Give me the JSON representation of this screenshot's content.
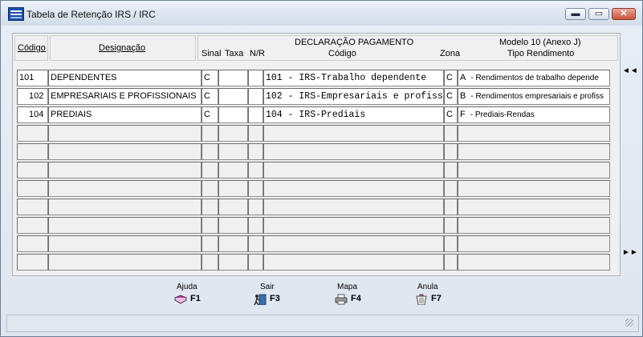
{
  "window": {
    "title": "Tabela de Retenção IRS / IRC",
    "controls": {
      "minimize": "▬",
      "maximize": "▭",
      "close": "✕"
    }
  },
  "header": {
    "codigo": "Código",
    "designacao": "Designação",
    "sinal": "Sinal",
    "taxa": "Taxa",
    "nr": "N/R",
    "declaracao": "DECLARAÇÃO PAGAMENTO",
    "declaracao_codigo": "Código",
    "zona": "Zona",
    "modelo": "Modelo 10 (Anexo J)",
    "tipo_rendimento": "Tipo Rendimento"
  },
  "rows": [
    {
      "codigo": "101",
      "designacao": "DEPENDENTES",
      "sinal": "C",
      "taxa": "",
      "nr": "",
      "dp_codigo": "101 - IRS-Trabalho dependente",
      "zona": "C",
      "tipo_letra": "A",
      "tipo_desc": "- Rendimentos de trabalho depende"
    },
    {
      "codigo": "102",
      "designacao": "EMPRESARIAIS E PROFISSIONAIS",
      "sinal": "C",
      "taxa": "",
      "nr": "",
      "dp_codigo": "102 - IRS-Empresariais e profiss",
      "zona": "C",
      "tipo_letra": "B",
      "tipo_desc": "- Rendimentos empresariais e profiss"
    },
    {
      "codigo": "104",
      "designacao": "PREDIAIS",
      "sinal": "C",
      "taxa": "",
      "nr": "",
      "dp_codigo": "104 - IRS-Prediais",
      "zona": "C",
      "tipo_letra": "F",
      "tipo_desc": "- Prediais-Rendas"
    },
    {
      "codigo": "",
      "designacao": "",
      "sinal": "",
      "taxa": "",
      "nr": "",
      "dp_codigo": "",
      "zona": "",
      "tipo_letra": "",
      "tipo_desc": ""
    },
    {
      "codigo": "",
      "designacao": "",
      "sinal": "",
      "taxa": "",
      "nr": "",
      "dp_codigo": "",
      "zona": "",
      "tipo_letra": "",
      "tipo_desc": ""
    },
    {
      "codigo": "",
      "designacao": "",
      "sinal": "",
      "taxa": "",
      "nr": "",
      "dp_codigo": "",
      "zona": "",
      "tipo_letra": "",
      "tipo_desc": ""
    },
    {
      "codigo": "",
      "designacao": "",
      "sinal": "",
      "taxa": "",
      "nr": "",
      "dp_codigo": "",
      "zona": "",
      "tipo_letra": "",
      "tipo_desc": ""
    },
    {
      "codigo": "",
      "designacao": "",
      "sinal": "",
      "taxa": "",
      "nr": "",
      "dp_codigo": "",
      "zona": "",
      "tipo_letra": "",
      "tipo_desc": ""
    },
    {
      "codigo": "",
      "designacao": "",
      "sinal": "",
      "taxa": "",
      "nr": "",
      "dp_codigo": "",
      "zona": "",
      "tipo_letra": "",
      "tipo_desc": ""
    },
    {
      "codigo": "",
      "designacao": "",
      "sinal": "",
      "taxa": "",
      "nr": "",
      "dp_codigo": "",
      "zona": "",
      "tipo_letra": "",
      "tipo_desc": ""
    },
    {
      "codigo": "",
      "designacao": "",
      "sinal": "",
      "taxa": "",
      "nr": "",
      "dp_codigo": "",
      "zona": "",
      "tipo_letra": "",
      "tipo_desc": ""
    }
  ],
  "nav": {
    "first": "◄◄",
    "last": "►►"
  },
  "fkeys": [
    {
      "label": "Ajuda",
      "key": "F1",
      "icon": "book-icon"
    },
    {
      "label": "Sair",
      "key": "F3",
      "icon": "exit-door-icon"
    },
    {
      "label": "Mapa",
      "key": "F4",
      "icon": "printer-icon"
    },
    {
      "label": "Anula",
      "key": "F7",
      "icon": "trash-icon"
    }
  ]
}
